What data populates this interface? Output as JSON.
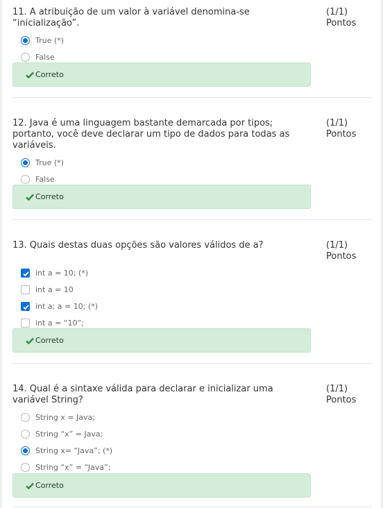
{
  "questions": [
    {
      "text": "11. A atribuição de um valor à variável denomina-se\n“inicialização”.",
      "points": "(1/1)\nPontos",
      "type": "radio",
      "options": [
        {
          "label": "True (*)",
          "checked": true
        },
        {
          "label": "False",
          "checked": false
        }
      ],
      "feedback": "Correto"
    },
    {
      "text": "12. Java é uma linguagem bastante demarcada por tipos;\nportanto, você deve declarar um tipo de dados para todas as\nvariáveis.",
      "points": "(1/1)\nPontos",
      "type": "radio",
      "options": [
        {
          "label": "True (*)",
          "checked": true
        },
        {
          "label": "False",
          "checked": false
        }
      ],
      "feedback": "Correto"
    },
    {
      "text": "13. Quais destas duas opções são valores válidos de a?",
      "points": "(1/1)\nPontos",
      "type": "checkbox",
      "options": [
        {
          "label": "int a = 10; (*)",
          "checked": true
        },
        {
          "label": "int a = 10",
          "checked": false
        },
        {
          "label": "int a; a = 10; (*)",
          "checked": true
        },
        {
          "label": "int a = “10”;",
          "checked": false
        }
      ],
      "feedback": "Correto"
    },
    {
      "text": "14. Qual é a sintaxe válida para declarar e inicializar uma\nvariável String?",
      "points": "(1/1)\nPontos",
      "type": "radio",
      "options": [
        {
          "label": "String x = Java;",
          "checked": false
        },
        {
          "label": "String “x” = Java;",
          "checked": false
        },
        {
          "label": "String x= “Java”; (*)",
          "checked": true
        },
        {
          "label": "String “x” = “Java”;",
          "checked": false
        }
      ],
      "feedback": "Correto"
    }
  ],
  "colors": {
    "accent": "#0d6fd1",
    "correct_bg": "#d4ecd9",
    "correct_check": "#2e8b3a"
  }
}
